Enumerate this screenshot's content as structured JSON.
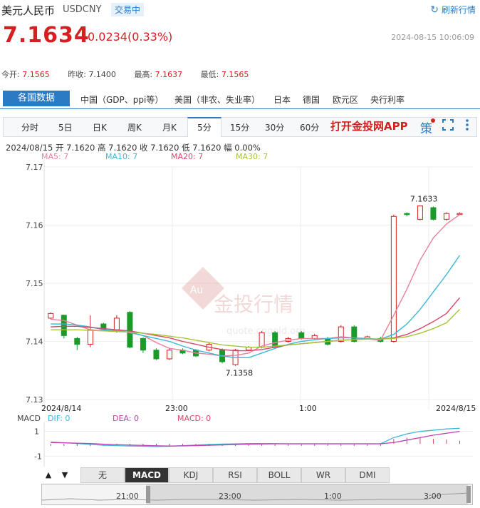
{
  "header": {
    "name": "美元人民币",
    "code": "USDCNY",
    "badge": "交易中",
    "refresh_label": "刷新行情"
  },
  "quote": {
    "price": "7.1634",
    "change": "0.0234(0.33%)",
    "datetime": "2024-08-15 10:06:09"
  },
  "stats": [
    {
      "label": "今开:",
      "value": "7.1565"
    },
    {
      "label": "昨收:",
      "value": "7.1400"
    },
    {
      "label": "最高:",
      "value": "7.1637"
    },
    {
      "label": "最低:",
      "value": "7.1565"
    }
  ],
  "tabs": {
    "active": "各国数据",
    "items": [
      "中国（GDP、ppi等）",
      "美国（非农、失业率）",
      "日本",
      "德国",
      "欧元区",
      "央行利率"
    ]
  },
  "periods": {
    "items": [
      "分时",
      "5日",
      "日K",
      "周K",
      "月K",
      "5分",
      "15分",
      "30分",
      "60分"
    ],
    "active": "5分",
    "app_link": "打开金投网APP",
    "ce_icon": "策"
  },
  "ohlc_line": "2024/08/15  开 7.1620  高 7.1620  收 7.1620  低 7.1620  幅 0.00%",
  "ma": [
    {
      "label": "MA5: 7",
      "color": "#e8809a"
    },
    {
      "label": "MA10: 7",
      "color": "#3bb8d8"
    },
    {
      "label": "MA20: 7",
      "color": "#d6476a"
    },
    {
      "label": "MA30: 7",
      "color": "#a6c43a"
    }
  ],
  "watermark": {
    "text": "金投行情",
    "url": "quote.cngold.org",
    "logo": "Au"
  },
  "chart_data": {
    "type": "candlestick",
    "y_ticks": [
      "7.17",
      "7.16",
      "7.15",
      "7.14",
      "7.13"
    ],
    "ylim": [
      7.13,
      7.17
    ],
    "x_labels": [
      "2024/8/14",
      "23:00",
      "1:00",
      "2024/8/15"
    ],
    "annotations": [
      {
        "text": "7.1633",
        "value": 7.1633
      },
      {
        "text": "7.1358",
        "value": 7.1358
      }
    ],
    "candles": [
      {
        "o": 7.144,
        "c": 7.1448,
        "h": 7.145,
        "l": 7.1438
      },
      {
        "o": 7.1445,
        "c": 7.141,
        "h": 7.1446,
        "l": 7.1405
      },
      {
        "o": 7.1405,
        "c": 7.1395,
        "h": 7.1408,
        "l": 7.1385
      },
      {
        "o": 7.1395,
        "c": 7.142,
        "h": 7.1445,
        "l": 7.139
      },
      {
        "o": 7.143,
        "c": 7.142,
        "h": 7.1432,
        "l": 7.1418
      },
      {
        "o": 7.142,
        "c": 7.144,
        "h": 7.1445,
        "l": 7.1415
      },
      {
        "o": 7.145,
        "c": 7.139,
        "h": 7.1452,
        "l": 7.1388
      },
      {
        "o": 7.1405,
        "c": 7.1385,
        "h": 7.1407,
        "l": 7.138
      },
      {
        "o": 7.1385,
        "c": 7.137,
        "h": 7.1388,
        "l": 7.1368
      },
      {
        "o": 7.137,
        "c": 7.1385,
        "h": 7.1388,
        "l": 7.1368
      },
      {
        "o": 7.1385,
        "c": 7.138,
        "h": 7.1388,
        "l": 7.1378
      },
      {
        "o": 7.1385,
        "c": 7.1375,
        "h": 7.1387,
        "l": 7.1373
      },
      {
        "o": 7.1385,
        "c": 7.1395,
        "h": 7.1398,
        "l": 7.1383
      },
      {
        "o": 7.1385,
        "c": 7.1365,
        "h": 7.1388,
        "l": 7.1362
      },
      {
        "o": 7.136,
        "c": 7.1385,
        "h": 7.1387,
        "l": 7.1358
      },
      {
        "o": 7.1385,
        "c": 7.139,
        "h": 7.1392,
        "l": 7.1383
      },
      {
        "o": 7.139,
        "c": 7.1415,
        "h": 7.1418,
        "l": 7.1388
      },
      {
        "o": 7.1415,
        "c": 7.139,
        "h": 7.1418,
        "l": 7.1388
      },
      {
        "o": 7.14,
        "c": 7.1405,
        "h": 7.1408,
        "l": 7.1398
      },
      {
        "o": 7.1415,
        "c": 7.1405,
        "h": 7.1418,
        "l": 7.1403
      },
      {
        "o": 7.1405,
        "c": 7.141,
        "h": 7.1413,
        "l": 7.1403
      },
      {
        "o": 7.1405,
        "c": 7.1395,
        "h": 7.1408,
        "l": 7.1393
      },
      {
        "o": 7.14,
        "c": 7.1425,
        "h": 7.1428,
        "l": 7.1398
      },
      {
        "o": 7.1425,
        "c": 7.14,
        "h": 7.1428,
        "l": 7.1398
      },
      {
        "o": 7.1405,
        "c": 7.1408,
        "h": 7.141,
        "l": 7.1403
      },
      {
        "o": 7.1405,
        "c": 7.14,
        "h": 7.1408,
        "l": 7.1398
      },
      {
        "o": 7.14,
        "c": 7.1615,
        "h": 7.1618,
        "l": 7.1398
      },
      {
        "o": 7.162,
        "c": 7.1618,
        "h": 7.1622,
        "l": 7.1615
      },
      {
        "o": 7.161,
        "c": 7.1633,
        "h": 7.1633,
        "l": 7.1608
      },
      {
        "o": 7.163,
        "c": 7.161,
        "h": 7.1632,
        "l": 7.1608
      },
      {
        "o": 7.161,
        "c": 7.162,
        "h": 7.1622,
        "l": 7.1608
      },
      {
        "o": 7.162,
        "c": 7.162,
        "h": 7.1622,
        "l": 7.1618
      }
    ],
    "series": [
      {
        "name": "MA5",
        "values": [
          7.1438,
          7.1436,
          7.1428,
          7.142,
          7.1418,
          7.142,
          7.1415,
          7.141,
          7.1398,
          7.1388,
          7.1385,
          7.138,
          7.1378,
          7.1375,
          7.1376,
          7.138,
          7.1392,
          7.1398,
          7.1402,
          7.1405,
          7.1405,
          7.1405,
          7.1408,
          7.1406,
          7.1404,
          7.1402,
          7.1445,
          7.149,
          7.154,
          7.1578,
          7.1602,
          7.1618
        ]
      },
      {
        "name": "MA10",
        "values": [
          7.143,
          7.143,
          7.1428,
          7.1425,
          7.142,
          7.1418,
          7.1416,
          7.141,
          7.1405,
          7.14,
          7.1392,
          7.1385,
          7.138,
          7.1375,
          7.1372,
          7.1372,
          7.138,
          7.1388,
          7.1395,
          7.14,
          7.1403,
          7.1405,
          7.1406,
          7.1406,
          7.1405,
          7.1404,
          7.1412,
          7.143,
          7.1455,
          7.1485,
          7.1515,
          7.1548
        ]
      },
      {
        "name": "MA20",
        "values": [
          7.1425,
          7.1426,
          7.1426,
          7.1424,
          7.1422,
          7.142,
          7.1418,
          7.1414,
          7.141,
          7.1406,
          7.14,
          7.1395,
          7.139,
          7.1386,
          7.1384,
          7.1384,
          7.1386,
          7.139,
          7.1394,
          7.1396,
          7.1398,
          7.14,
          7.1402,
          7.1403,
          7.1404,
          7.1404,
          7.1406,
          7.1412,
          7.1422,
          7.1434,
          7.1448,
          7.1475
        ]
      },
      {
        "name": "MA30",
        "values": [
          7.142,
          7.142,
          7.142,
          7.1419,
          7.1418,
          7.1417,
          7.1416,
          7.1414,
          7.1412,
          7.1409,
          7.1406,
          7.1402,
          7.1398,
          7.1394,
          7.1392,
          7.139,
          7.139,
          7.1392,
          7.1394,
          7.1396,
          7.1398,
          7.14,
          7.1402,
          7.1403,
          7.1404,
          7.1404,
          7.1405,
          7.1408,
          7.1414,
          7.1422,
          7.1432,
          7.1455
        ]
      }
    ]
  },
  "macd": {
    "label": "MACD",
    "dif": "DIF: 0",
    "dea": "DEA: 0",
    "macd": "MACD: 0",
    "dif_color": "#3bb8d8",
    "dea_color": "#c040b0",
    "macd_color": "#d6476a",
    "y_ticks": [
      "1",
      "-1"
    ],
    "dif_values": [
      0.15,
      0.08,
      0.02,
      -0.05,
      -0.12,
      -0.15,
      -0.18,
      -0.2,
      -0.22,
      -0.2,
      -0.15,
      -0.1,
      -0.05,
      -0.02,
      0,
      0.02,
      0.02,
      0.01,
      0,
      0,
      0,
      0,
      0,
      0,
      0,
      0,
      0.5,
      0.8,
      1.0,
      1.1,
      1.2,
      1.25
    ],
    "dea_values": [
      0.1,
      0.08,
      0.05,
      0.02,
      -0.03,
      -0.07,
      -0.1,
      -0.13,
      -0.16,
      -0.18,
      -0.17,
      -0.15,
      -0.12,
      -0.09,
      -0.06,
      -0.03,
      -0.01,
      0,
      0,
      0,
      0,
      0,
      0,
      0,
      0,
      0,
      0.1,
      0.3,
      0.5,
      0.7,
      0.85,
      1.0
    ],
    "bars": [
      0.05,
      0,
      -0.03,
      -0.07,
      -0.09,
      -0.08,
      -0.08,
      -0.07,
      -0.06,
      -0.02,
      0.02,
      0.05,
      0.07,
      0.07,
      0.06,
      0.05,
      0.03,
      0.01,
      0,
      0,
      0,
      0,
      0,
      0,
      0,
      0,
      0.4,
      0.5,
      0.5,
      0.4,
      0.35,
      0.25
    ]
  },
  "indicator_tabs": {
    "items": [
      "无",
      "MACD",
      "KDJ",
      "RSI",
      "BOLL",
      "WR",
      "DMI"
    ],
    "active": "MACD",
    "up_arrow": "▲",
    "down_arrow": "▼"
  },
  "navigator": {
    "labels": [
      "21:00",
      "23:00",
      "1:00",
      "3:00"
    ]
  }
}
